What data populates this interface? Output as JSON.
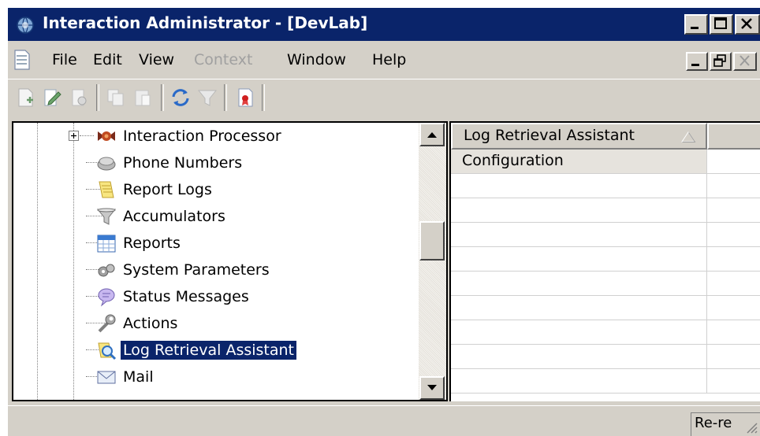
{
  "window": {
    "title": "Interaction Administrator - [DevLab]",
    "colors": {
      "titlebar": "#0a246a",
      "face": "#d4d0c8",
      "selection": "#0a246a"
    }
  },
  "menu": {
    "items": [
      {
        "label": "File",
        "enabled": true
      },
      {
        "label": "Edit",
        "enabled": true
      },
      {
        "label": "View",
        "enabled": true
      },
      {
        "label": "Context",
        "enabled": false
      },
      {
        "label": "Window",
        "enabled": true
      },
      {
        "label": "Help",
        "enabled": true
      }
    ]
  },
  "toolbar": {
    "icons": [
      "new-icon",
      "edit-icon",
      "properties-icon",
      "copy-icon",
      "paste-icon",
      "refresh-icon",
      "filter-icon",
      "bookmark-icon"
    ]
  },
  "tree": {
    "items": [
      {
        "label": "Interaction Processor",
        "icon": "interaction-processor-icon",
        "expandable": true
      },
      {
        "label": "Phone Numbers",
        "icon": "phone-icon"
      },
      {
        "label": "Report Logs",
        "icon": "report-logs-icon"
      },
      {
        "label": "Accumulators",
        "icon": "funnel-icon"
      },
      {
        "label": "Reports",
        "icon": "calendar-icon"
      },
      {
        "label": "System Parameters",
        "icon": "gears-icon"
      },
      {
        "label": "Status Messages",
        "icon": "speech-bubble-icon"
      },
      {
        "label": "Actions",
        "icon": "wrench-icon"
      },
      {
        "label": "Log Retrieval Assistant",
        "icon": "magnifier-icon",
        "selected": true
      },
      {
        "label": "Mail",
        "icon": "envelope-icon"
      }
    ]
  },
  "list": {
    "column_header": "Log Retrieval Assistant",
    "rows": [
      "Configuration"
    ]
  },
  "status": {
    "panel_text": "Re-re"
  }
}
